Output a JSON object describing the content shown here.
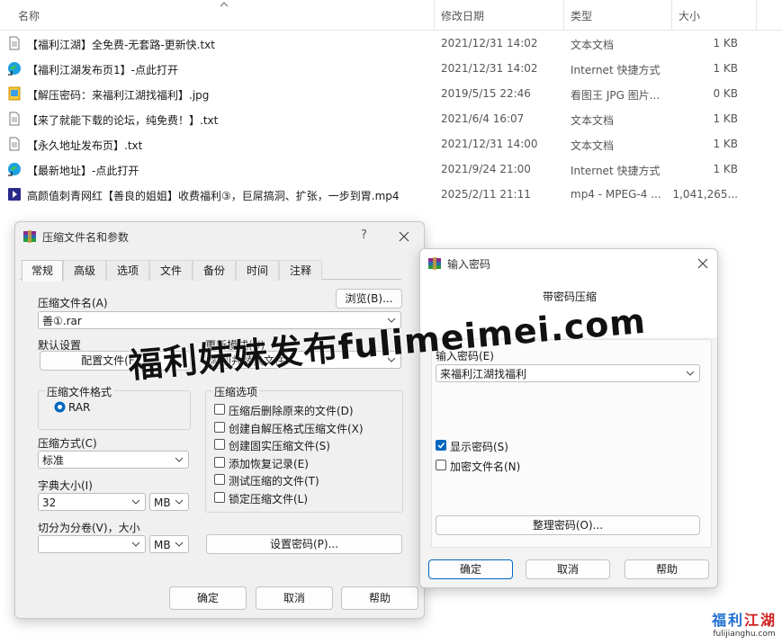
{
  "explorer": {
    "columns": {
      "name": "名称",
      "date": "修改日期",
      "type": "类型",
      "size": "大小"
    },
    "files": [
      {
        "icon": "text-file-icon",
        "name": "【福利江湖】全免费-无套路-更新快.txt",
        "date": "2021/12/31 14:02",
        "type": "文本文档",
        "size": "1 KB"
      },
      {
        "icon": "edge-shortcut-icon",
        "name": "【福利江湖发布页1】-点此打开",
        "date": "2021/12/31 14:02",
        "type": "Internet 快捷方式",
        "size": "1 KB"
      },
      {
        "icon": "image-file-icon",
        "name": "【解压密码：来福利江湖找福利】.jpg",
        "date": "2019/5/15 22:46",
        "type": "看图王 JPG 图片...",
        "size": "0 KB"
      },
      {
        "icon": "text-file-icon",
        "name": "【来了就能下载的论坛，纯免费！】.txt",
        "date": "2021/6/4 16:07",
        "type": "文本文档",
        "size": "1 KB"
      },
      {
        "icon": "text-file-icon",
        "name": "【永久地址发布页】.txt",
        "date": "2021/12/31 14:00",
        "type": "文本文档",
        "size": "1 KB"
      },
      {
        "icon": "edge-shortcut-icon",
        "name": "【最新地址】-点此打开",
        "date": "2021/9/24 21:00",
        "type": "Internet 快捷方式",
        "size": "1 KB"
      },
      {
        "icon": "video-file-icon",
        "name": "高颜值刺青网红【善良的姐姐】收费福利③，巨屌搞洞、扩张，一步到胃.mp4",
        "date": "2025/2/11 21:11",
        "type": "mp4 - MPEG-4 ...",
        "size": "1,041,265..."
      }
    ]
  },
  "archive_dialog": {
    "title": "压缩文件名和参数",
    "help": "?",
    "tabs": [
      "常规",
      "高级",
      "选项",
      "文件",
      "备份",
      "时间",
      "注释"
    ],
    "archive_name_label": "压缩文件名(A)",
    "browse": "浏览(B)...",
    "archive_name": "善①.rar",
    "default_settings": "默认设置",
    "profiles": "配置文件(F)...",
    "update_mode_label": "更新模式(U)",
    "update_mode": "添加并替换文件",
    "format_label": "压缩文件格式",
    "format_rar": "RAR",
    "options_label": "压缩选项",
    "options": [
      {
        "label": "压缩后删除原来的文件(D)",
        "checked": false
      },
      {
        "label": "创建自解压格式压缩文件(X)",
        "checked": false
      },
      {
        "label": "创建固实压缩文件(S)",
        "checked": false
      },
      {
        "label": "添加恢复记录(E)",
        "checked": false
      },
      {
        "label": "测试压缩的文件(T)",
        "checked": false
      },
      {
        "label": "锁定压缩文件(L)",
        "checked": false
      }
    ],
    "method_label": "压缩方式(C)",
    "method": "标准",
    "dict_label": "字典大小(I)",
    "dict_value": "32",
    "dict_unit": "MB",
    "split_label": "切分为分卷(V)，大小",
    "split_value": "",
    "split_unit": "MB",
    "set_password": "设置密码(P)...",
    "ok": "确定",
    "cancel": "取消",
    "helpbtn": "帮助"
  },
  "password_dialog": {
    "title": "输入密码",
    "heading": "带密码压缩",
    "enter_label": "输入密码(E)",
    "enter_value": "来福利江湖找福利",
    "show_password": "显示密码(S)",
    "show_checked": true,
    "encrypt_names": "加密文件名(N)",
    "encrypt_checked": false,
    "organize": "整理密码(O)...",
    "ok": "确定",
    "cancel": "取消",
    "helpbtn": "帮助"
  },
  "watermark": "福利妹妹发布fulimeimei.com",
  "logo": {
    "cn_a": "福利",
    "cn_b": "江湖",
    "en": "fulijianghu.com"
  },
  "colors": {
    "accent": "#0067c0",
    "logo_blue": "#1e6fd0",
    "logo_red": "#d02020"
  }
}
